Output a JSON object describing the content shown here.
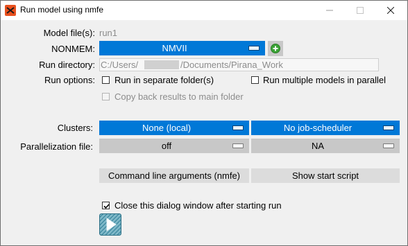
{
  "window": {
    "title": "Run model using nmfe",
    "app_icon": "pirana-logo-icon",
    "controls": [
      "minimize-icon",
      "maximize-icon",
      "close-icon"
    ]
  },
  "model_files": {
    "label": "Model file(s):",
    "value": "run1"
  },
  "nonmem": {
    "label": "NONMEM:",
    "selected": "NMVII",
    "add_icon": "add-circle-icon"
  },
  "run_directory": {
    "label": "Run directory:",
    "value_prefix": "C:/Users/",
    "value_suffix": "/Documents/Pirana_Work"
  },
  "run_options": {
    "label": "Run options:",
    "separate_folders": {
      "label": "Run in separate folder(s)",
      "checked": false
    },
    "multiple_parallel": {
      "label": "Run multiple models in parallel",
      "checked": false
    },
    "copy_back": {
      "label": "Copy back results to main folder",
      "checked": false,
      "enabled": false
    }
  },
  "clusters": {
    "label": "Clusters:",
    "cluster_selected": "None (local)",
    "scheduler_selected": "No job-scheduler"
  },
  "parallelization": {
    "label": "Parallelization file:",
    "file_selected": "off",
    "option_selected": "NA"
  },
  "buttons": {
    "command_line": "Command line arguments (nmfe)",
    "start_script": "Show start script"
  },
  "close_after_run": {
    "label": "Close this dialog window after starting run",
    "checked": true
  },
  "run_button_icon": "play-icon",
  "colors": {
    "accent": "#0078d7",
    "dropdown_gray": "#c8c8c8",
    "dialog_bg": "#f0f0f0",
    "add_green": "#3aa335"
  }
}
